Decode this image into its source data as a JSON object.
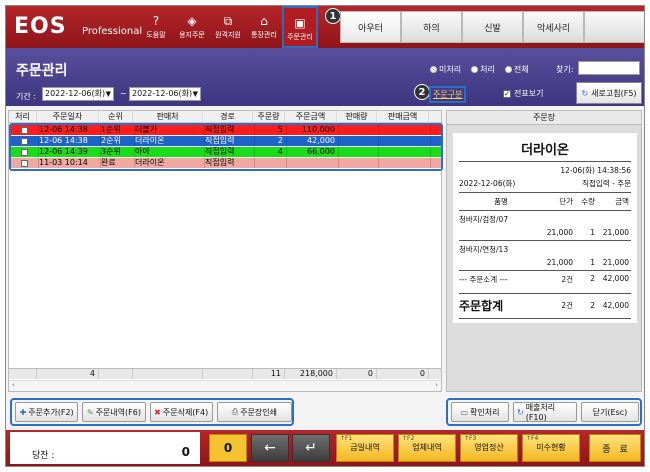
{
  "app": {
    "logo": "EOS",
    "logo_sub": "Professional"
  },
  "topnav": [
    {
      "label": "도움말",
      "icon": "question-icon",
      "glyph": "?"
    },
    {
      "label": "용지주문",
      "icon": "stack-icon",
      "glyph": "◈"
    },
    {
      "label": "원격지원",
      "icon": "remote-icon",
      "glyph": "⧉"
    },
    {
      "label": "통장관리",
      "icon": "bank-icon",
      "glyph": "⌂"
    },
    {
      "label": "주문관리",
      "icon": "box-icon",
      "glyph": "▣"
    }
  ],
  "categories": [
    "아우터",
    "하의",
    "신발",
    "악세사리"
  ],
  "callouts": {
    "one": "1",
    "two": "2"
  },
  "header": {
    "title": "주문관리",
    "period_label": "기간 :",
    "date_from": "2022-12-06(화)",
    "date_to": "2022-12-06(화)",
    "tilde": "~",
    "radios": [
      {
        "label": "미처리",
        "checked": true
      },
      {
        "label": "처리",
        "checked": false
      },
      {
        "label": "전체",
        "checked": false
      }
    ],
    "search_label": "찾기:",
    "order_type": "주문구분",
    "slip_view": "전표보기",
    "refresh": "새로고침(F5)"
  },
  "table": {
    "columns": [
      "처리",
      "주문일자",
      "순위",
      "판매처",
      "경로",
      "주문량",
      "주문금액",
      "판매량",
      "판매금액"
    ],
    "rows": [
      {
        "date": "12-06 14:38",
        "rank": "1순위",
        "seller": "더블가",
        "route": "직접입력",
        "qty": "5",
        "amount": "110,000",
        "bg": "#ff1c1c",
        "fg": "#000000"
      },
      {
        "date": "12-06 14:38",
        "rank": "2순위",
        "seller": "더라이온",
        "route": "직접입력",
        "qty": "2",
        "amount": "42,000",
        "bg": "#1e63c8",
        "fg": "#ffffff"
      },
      {
        "date": "12-06 14:39",
        "rank": "3순위",
        "seller": "아아",
        "route": "직접입력",
        "qty": "4",
        "amount": "66,000",
        "bg": "#19dd19",
        "fg": "#000000"
      },
      {
        "date": "11-03 10:14",
        "rank": "완료",
        "seller": "더라이온",
        "route": "직접입력",
        "qty": "",
        "amount": "",
        "bg": "#f0a9a0",
        "fg": "#000000"
      }
    ],
    "footer": {
      "count": "4",
      "qty": "11",
      "amount": "218,000",
      "sale_qty": "0",
      "sale_amount": "0"
    }
  },
  "receipt": {
    "header": "주문장",
    "store": "더라이온",
    "datetime": "12-06(화) 14:38:56",
    "date": "2022-12-06(화)",
    "type": "직접입력 - 주문",
    "col_item": "품명",
    "col_price": "단가",
    "col_qty": "수량",
    "col_amount": "금액",
    "items": [
      {
        "name": "청바지/검정/07",
        "price": "21,000",
        "qty": "1",
        "amount": "21,000"
      },
      {
        "name": "청바지/연청/13",
        "price": "21,000",
        "qty": "1",
        "amount": "21,000"
      }
    ],
    "subtotal_label": "--- 주문소계 ---",
    "subtotal_count": "2건",
    "subtotal_qty": "2",
    "subtotal_amount": "42,000",
    "total_label": "주문합계",
    "total_count": "2건",
    "total_qty": "2",
    "total_amount": "42,000"
  },
  "buttons_left": [
    {
      "label": "주문추가(F2)",
      "icon": "plus-icon",
      "glyph": "✚",
      "color": "#2a6fd0"
    },
    {
      "label": "주문내역(F6)",
      "icon": "pencil-icon",
      "glyph": "✎",
      "color": "#3a9a3a"
    },
    {
      "label": "주문삭제(F4)",
      "icon": "delete-icon",
      "glyph": "✖",
      "color": "#d03030"
    },
    {
      "label": "주문장인쇄",
      "icon": "printer-icon",
      "glyph": "⎙",
      "color": "#555555"
    }
  ],
  "buttons_right": [
    {
      "label": "확인처리",
      "icon": "monitor-icon",
      "glyph": "▭",
      "color": "#555555"
    },
    {
      "label": "매출처리(F10)",
      "icon": "refresh-icon",
      "glyph": "↻",
      "color": "#2a6fd0"
    },
    {
      "label": "닫기(Esc)",
      "icon": "",
      "glyph": "",
      "color": "#000000"
    }
  ],
  "bottom": {
    "balance_label": "당잔 :",
    "balance_value": "0",
    "zero": "0",
    "back_glyph": "←",
    "enter_glyph": "↵",
    "fkeys": [
      {
        "key": "↑F1",
        "label": "금일내역"
      },
      {
        "key": "↑F2",
        "label": "업체내역"
      },
      {
        "key": "↑F3",
        "label": "영업정산"
      },
      {
        "key": "↑F4",
        "label": "미수현황"
      }
    ],
    "end": "종　료"
  },
  "colors": {
    "brand_red": "#a41d22",
    "header_purple": "#4a4190",
    "highlight_blue": "#2b6fc4"
  }
}
